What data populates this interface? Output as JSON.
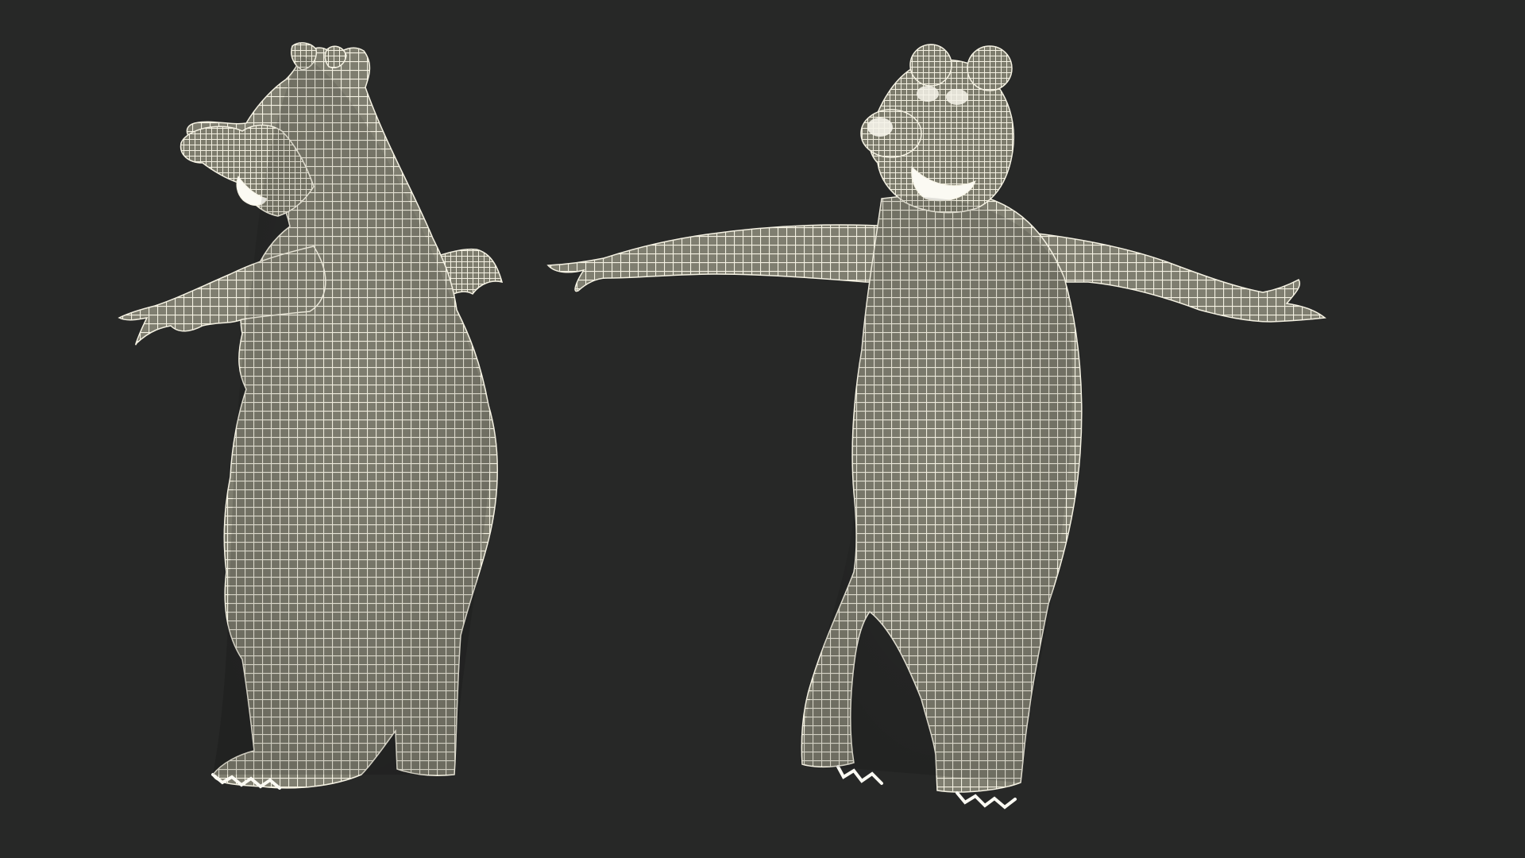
{
  "scene": {
    "background_color": "#272827",
    "mesh_fill_color": "#7f7e70",
    "wire_color": "#f4f1e2",
    "views": [
      {
        "id": "three-quarter-side"
      },
      {
        "id": "front"
      }
    ]
  }
}
